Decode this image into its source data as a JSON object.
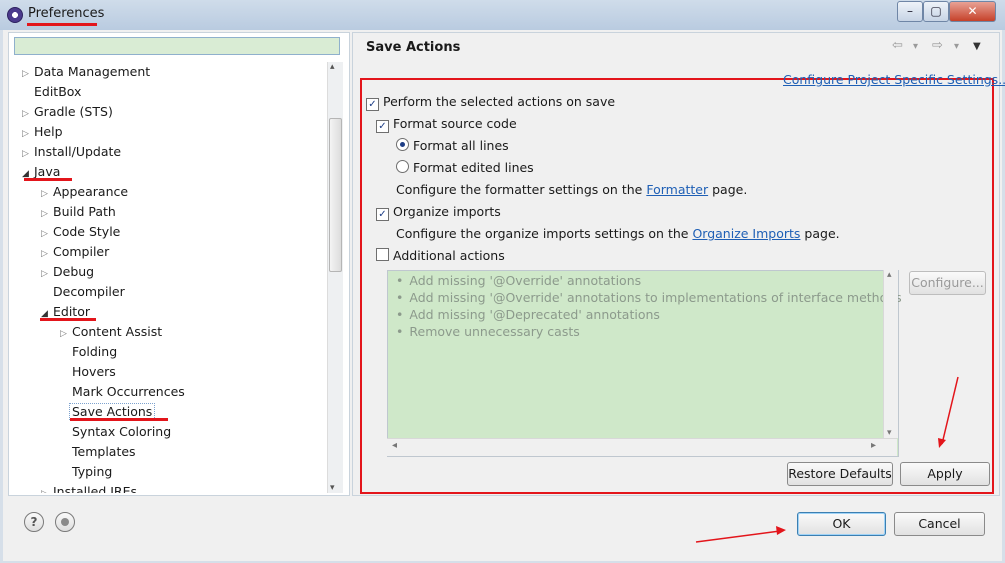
{
  "window": {
    "title": "Preferences",
    "minimize": "–",
    "maximize": "▢",
    "close": "✕"
  },
  "filter": {
    "value": ""
  },
  "tree": [
    {
      "label": "Data Management",
      "indent": 0,
      "expander": "closed"
    },
    {
      "label": "EditBox",
      "indent": 0,
      "expander": "none"
    },
    {
      "label": "Gradle (STS)",
      "indent": 0,
      "expander": "closed"
    },
    {
      "label": "Help",
      "indent": 0,
      "expander": "closed"
    },
    {
      "label": "Install/Update",
      "indent": 0,
      "expander": "closed"
    },
    {
      "label": "Java",
      "indent": 0,
      "expander": "open"
    },
    {
      "label": "Appearance",
      "indent": 1,
      "expander": "closed"
    },
    {
      "label": "Build Path",
      "indent": 1,
      "expander": "closed"
    },
    {
      "label": "Code Style",
      "indent": 1,
      "expander": "closed"
    },
    {
      "label": "Compiler",
      "indent": 1,
      "expander": "closed"
    },
    {
      "label": "Debug",
      "indent": 1,
      "expander": "closed"
    },
    {
      "label": "Decompiler",
      "indent": 1,
      "expander": "none"
    },
    {
      "label": "Editor",
      "indent": 1,
      "expander": "open"
    },
    {
      "label": "Content Assist",
      "indent": 2,
      "expander": "closed"
    },
    {
      "label": "Folding",
      "indent": 2,
      "expander": "none"
    },
    {
      "label": "Hovers",
      "indent": 2,
      "expander": "none"
    },
    {
      "label": "Mark Occurrences",
      "indent": 2,
      "expander": "none"
    },
    {
      "label": "Save Actions",
      "indent": 2,
      "expander": "none",
      "selected": true
    },
    {
      "label": "Syntax Coloring",
      "indent": 2,
      "expander": "none"
    },
    {
      "label": "Templates",
      "indent": 2,
      "expander": "none"
    },
    {
      "label": "Typing",
      "indent": 2,
      "expander": "none"
    },
    {
      "label": "Installed JREs",
      "indent": 1,
      "expander": "closed"
    }
  ],
  "page": {
    "title": "Save Actions",
    "configure_project_link": "Configure Project Specific Settings...",
    "perform_actions": {
      "label": "Perform the selected actions on save",
      "checked": true
    },
    "format_source": {
      "label": "Format source code",
      "checked": true
    },
    "format_all_lines": {
      "label": "Format all lines",
      "selected": true
    },
    "format_edited_lines": {
      "label": "Format edited lines",
      "selected": false
    },
    "formatter_text_before": "Configure the formatter settings on the",
    "formatter_link": "Formatter",
    "formatter_text_after": "page.",
    "organize_imports": {
      "label": "Organize imports",
      "checked": true
    },
    "organize_text_before": "Configure the organize imports settings on the",
    "organize_link": "Organize Imports",
    "organize_text_after": "page.",
    "additional_actions": {
      "label": "Additional actions",
      "checked": false
    },
    "actions": [
      "Add missing '@Override' annotations",
      "Add missing '@Override' annotations to implementations of interface methods",
      "Add missing '@Deprecated' annotations",
      "Remove unnecessary casts"
    ],
    "configure_button": "Configure...",
    "restore_defaults": "Restore Defaults",
    "apply": "Apply"
  },
  "footer": {
    "ok": "OK",
    "cancel": "Cancel"
  },
  "glyphs": {
    "bullet": "•",
    "check": "✓",
    "help": "?",
    "nav_back": "⇦",
    "nav_forward": "⇨",
    "dropdown": "▾",
    "menu": "▼",
    "tri_closed": "▷",
    "tri_open": "◢",
    "arrow_left": "◂",
    "arrow_right": "▸",
    "arrow_up": "▴",
    "arrow_down": "▾"
  },
  "colors": {
    "accent_red": "#e3151b",
    "link": "#1e5fb5",
    "list_bg": "#cfe8c9"
  }
}
